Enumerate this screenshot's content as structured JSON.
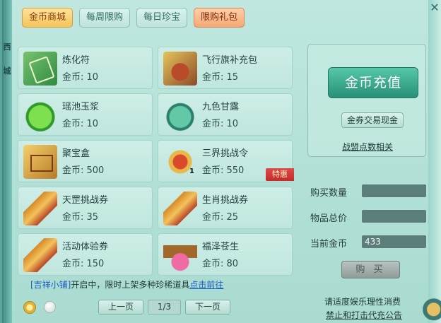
{
  "tabs": [
    {
      "label": "金币商城",
      "active": true
    },
    {
      "label": "每周限购",
      "active": false
    },
    {
      "label": "每日珍宝",
      "active": false
    },
    {
      "label": "限购礼包",
      "active": false
    }
  ],
  "left_strip_chars": [
    "西",
    "城"
  ],
  "items": [
    {
      "name": "炼化符",
      "price": "金币: 10",
      "icon": "talisman-icon"
    },
    {
      "name": "飞行旗补充包",
      "price": "金币: 15",
      "icon": "flag-pack-icon"
    },
    {
      "name": "瑶池玉浆",
      "price": "金币: 10",
      "icon": "jade-potion-icon"
    },
    {
      "name": "九色甘露",
      "price": "金币: 10",
      "icon": "dew-potion-icon"
    },
    {
      "name": "聚宝盒",
      "price": "金币: 500",
      "icon": "treasure-box-icon"
    },
    {
      "name": "三界挑战令",
      "price": "金币: 550",
      "icon": "challenge-token-icon",
      "count": "1",
      "special": "特惠"
    },
    {
      "name": "天罡挑战券",
      "price": "金币: 35",
      "icon": "scroll-icon"
    },
    {
      "name": "生肖挑战券",
      "price": "金币: 25",
      "icon": "scroll-icon"
    },
    {
      "name": "活动体验券",
      "price": "金币: 150",
      "icon": "scroll-icon"
    },
    {
      "name": "福泽苍生",
      "price": "金币: 80",
      "icon": "potion-bottle-icon"
    }
  ],
  "panel": {
    "recharge_label": "金币充值",
    "exchange_label": "金券交易现金",
    "alliance_link": "战盟点数相关"
  },
  "purchase": {
    "quantity_label": "购买数量",
    "quantity_value": "",
    "total_label": "物品总价",
    "total_value": "",
    "current_gold_label": "当前金币",
    "current_gold_value": "433",
    "buy_label": "购 买"
  },
  "notice": {
    "shop_name": "[吉祥小铺]",
    "message": "开启中，限时上架多种珍稀道具",
    "goto_link": "点击前往"
  },
  "pager": {
    "prev_label": "上一页",
    "page": "1/3",
    "next_label": "下一页"
  },
  "footer": {
    "health_notice": "请适度娱乐理性消费",
    "anti_fraud": "禁止和打击代充公告"
  },
  "colors": {
    "active_tab": "#f4c45a",
    "limited_tab": "#f5a874",
    "recharge_button": "#279076",
    "special_badge": "#c52a2a",
    "link": "#1b5fc2"
  }
}
